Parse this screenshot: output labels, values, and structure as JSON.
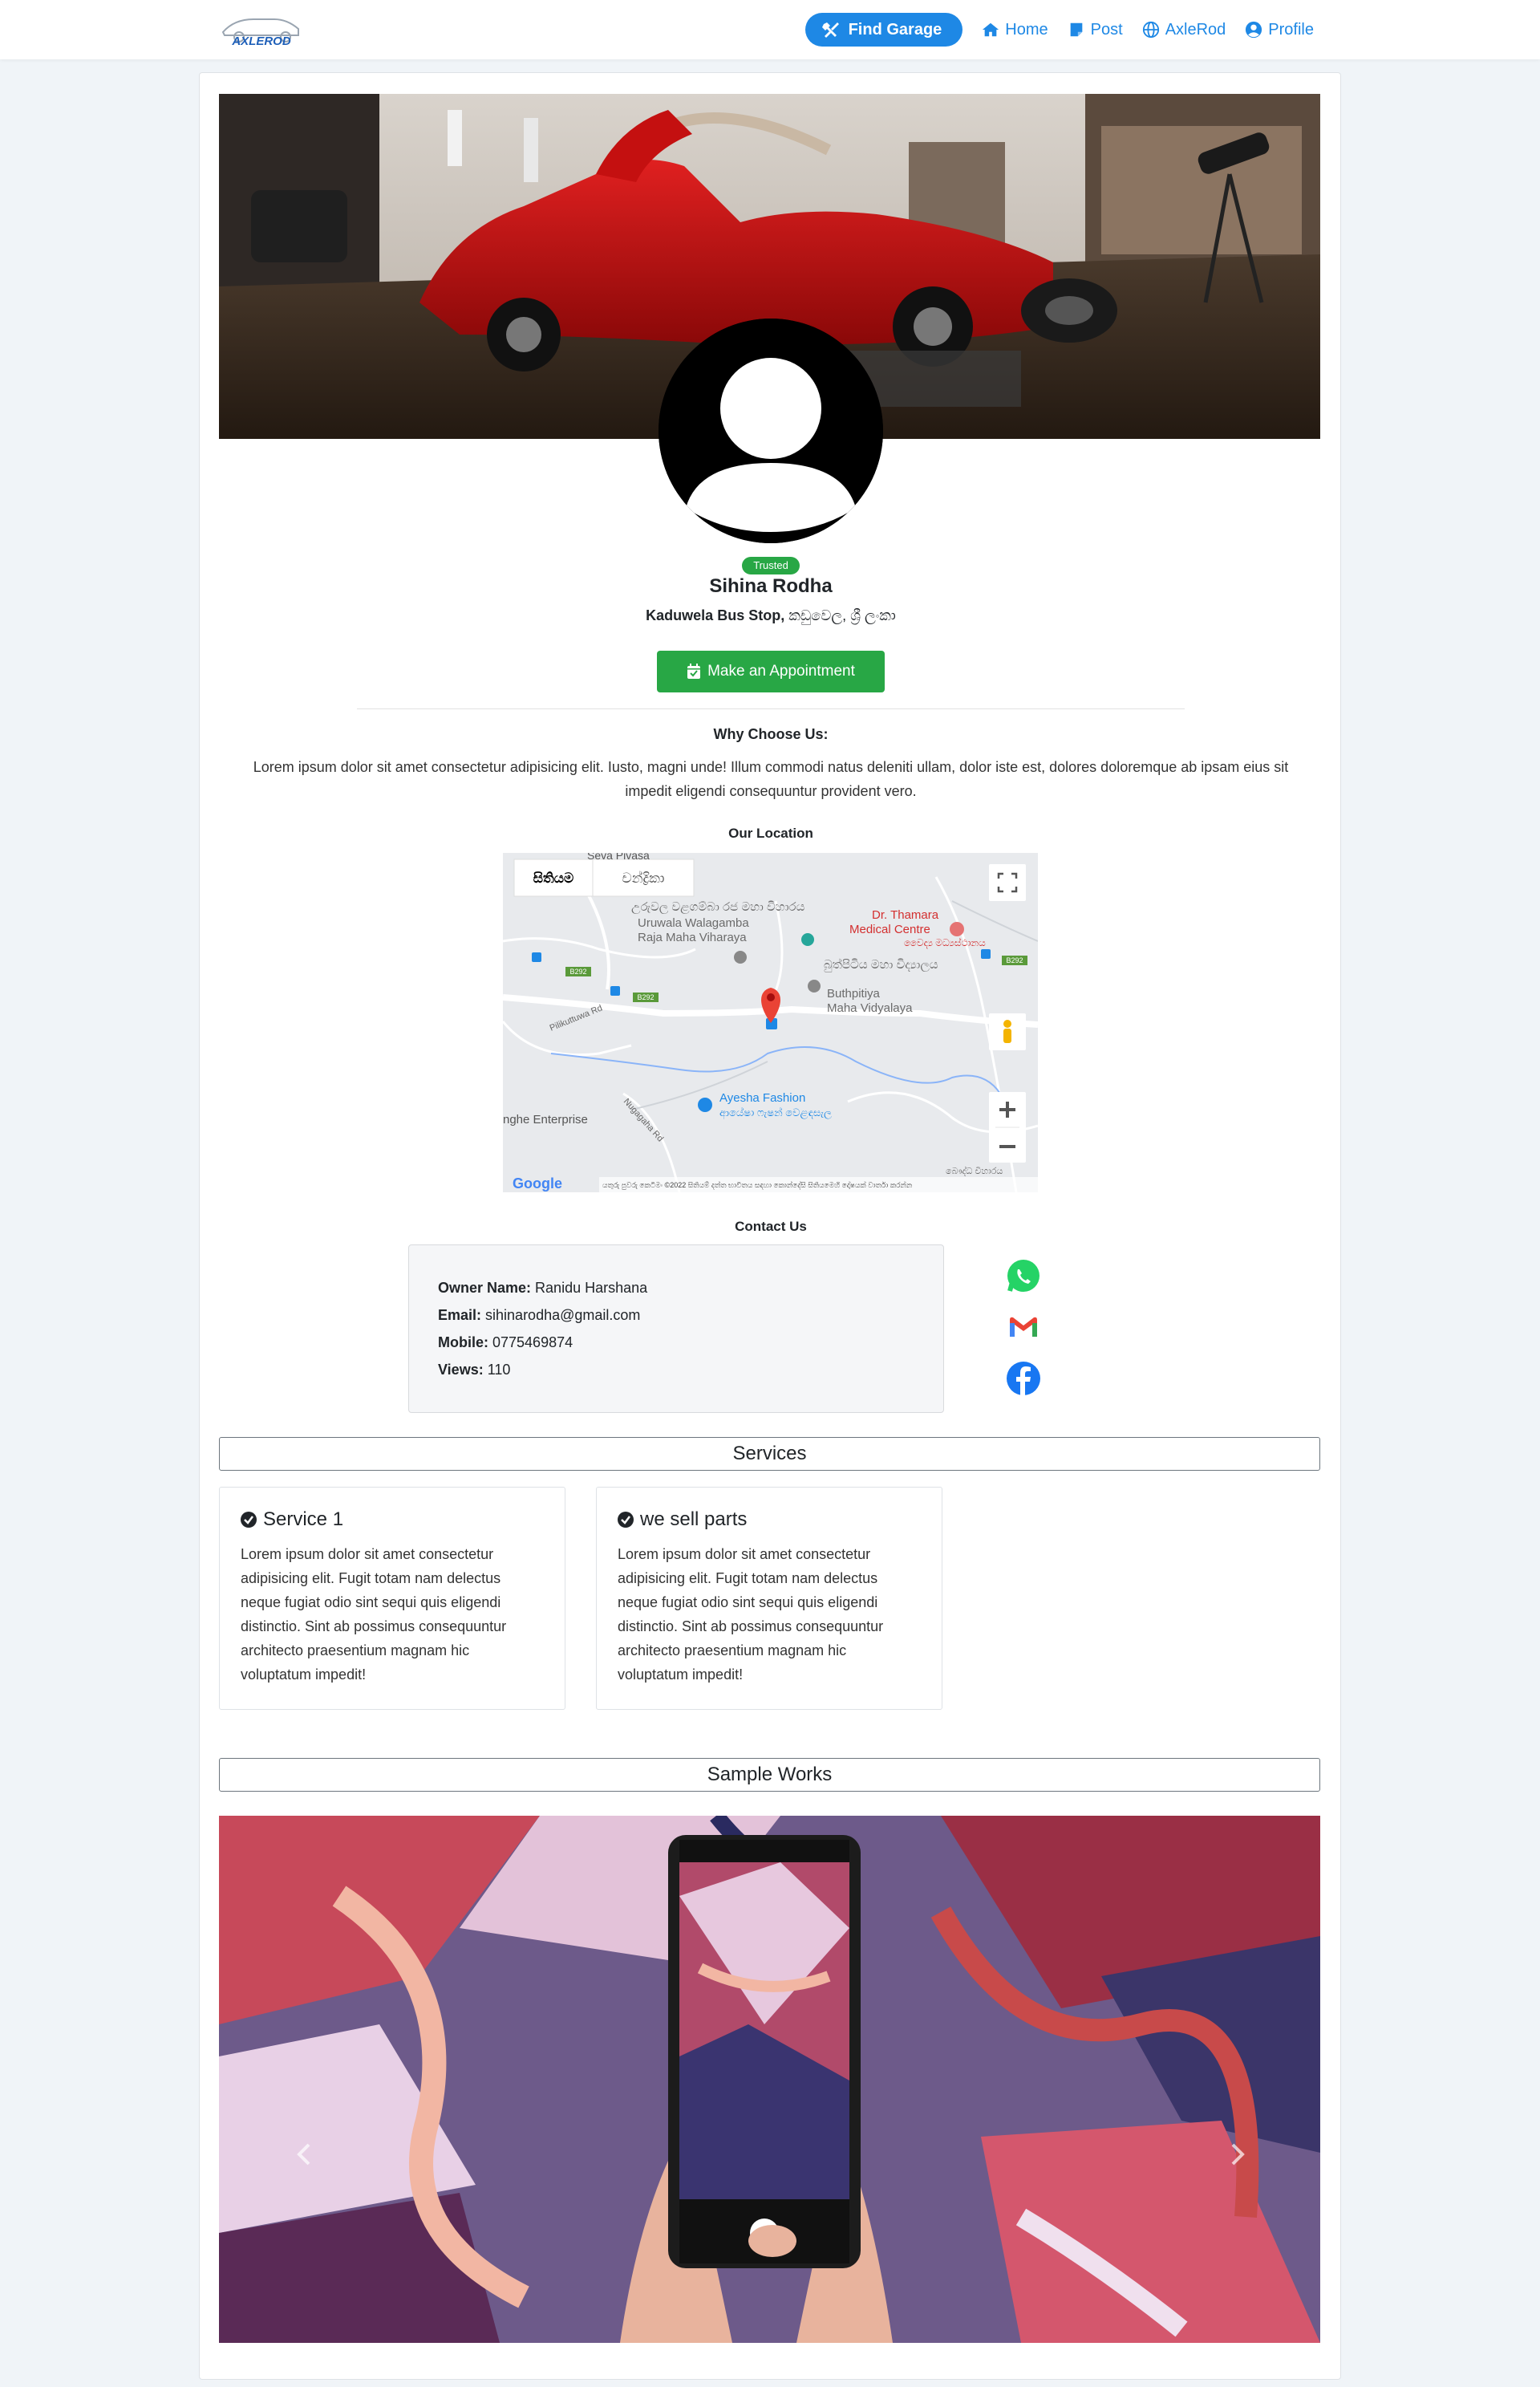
{
  "nav": {
    "logo_text": "AXLEROD",
    "find_garage": "Find Garage",
    "home": "Home",
    "post": "Post",
    "axlerod": "AxleRod",
    "profile": "Profile"
  },
  "profile": {
    "badge": "Trusted",
    "name": "Sihina Rodha",
    "address_bold": "Kaduwela Bus Stop,",
    "address_rest": " කඩුවෙල, ශ්‍රී ලංකා",
    "appointment_button": "Make an Appointment"
  },
  "why": {
    "title": "Why Choose Us:",
    "text": "Lorem ipsum dolor sit amet consectetur adipisicing elit. Iusto, magni unde! Illum commodi natus deleniti ullam, dolor iste est, dolores doloremque ab ipsam eius sit impedit eligendi consequuntur provident vero."
  },
  "location": {
    "title": "Our Location",
    "map_tab_map": "සිතියම",
    "map_tab_satellite": "චන්ද්‍රිකා",
    "labels": {
      "seva": "Seva Pivasa",
      "temple_si": "උරුවල වළගම්බා රජ මහා විහාරය",
      "temple_en1": "Uruwala Walagamba",
      "temple_en2": "Raja Maha Viharaya",
      "medical1": "Dr. Thamara",
      "medical2": "Medical Centre",
      "medical_si": "වෛද්‍ය මධ්‍යස්ථානය",
      "school_si": "බුත්පිටිය මහා විද්‍යාලය",
      "school_en1": "Buthpitiya",
      "school_en2": "Maha Vidyalaya",
      "fashion_en": "Ayesha Fashion",
      "fashion_si": "ආයේෂා ෆැෂන් වෙළඳසැල",
      "enterprise": "nghe Enterprise",
      "road1": "Pilikuttuwa Rd",
      "road2": "Nugagaha Rd",
      "b292": "B292",
      "google": "Google",
      "attribution": "යතුරු පුවරු කෙටිමං  ©2022 සිතියම් දත්ත  භාවිතය සඳහා කොන්දේසි  සිතියමෙහි දෝෂයක් වාර්තා කරන්න",
      "corner": "බෞද්ධ විහාරය"
    }
  },
  "contact": {
    "title": "Contact Us",
    "owner_label": "Owner Name:",
    "owner_value": " Ranidu Harshana",
    "email_label": "Email:",
    "email_value": " sihinarodha@gmail.com",
    "mobile_label": "Mobile:",
    "mobile_value": " 0775469874",
    "views_label": "Views:",
    "views_value": " 110"
  },
  "services": {
    "title": "Services",
    "items": [
      {
        "title": "Service 1",
        "text": "Lorem ipsum dolor sit amet consectetur adipisicing elit. Fugit totam nam delectus neque fugiat odio sint sequi quis eligendi distinctio. Sint ab possimus consequuntur architecto praesentium magnam hic voluptatum impedit!"
      },
      {
        "title": "we sell parts",
        "text": "Lorem ipsum dolor sit amet consectetur adipisicing elit. Fugit totam nam delectus neque fugiat odio sint sequi quis eligendi distinctio. Sint ab possimus consequuntur architecto praesentium magnam hic voluptatum impedit!"
      }
    ]
  },
  "works": {
    "title": "Sample Works"
  },
  "colors": {
    "primary": "#1e88e5",
    "success": "#28a745",
    "page_bg": "#f0f4f8"
  }
}
